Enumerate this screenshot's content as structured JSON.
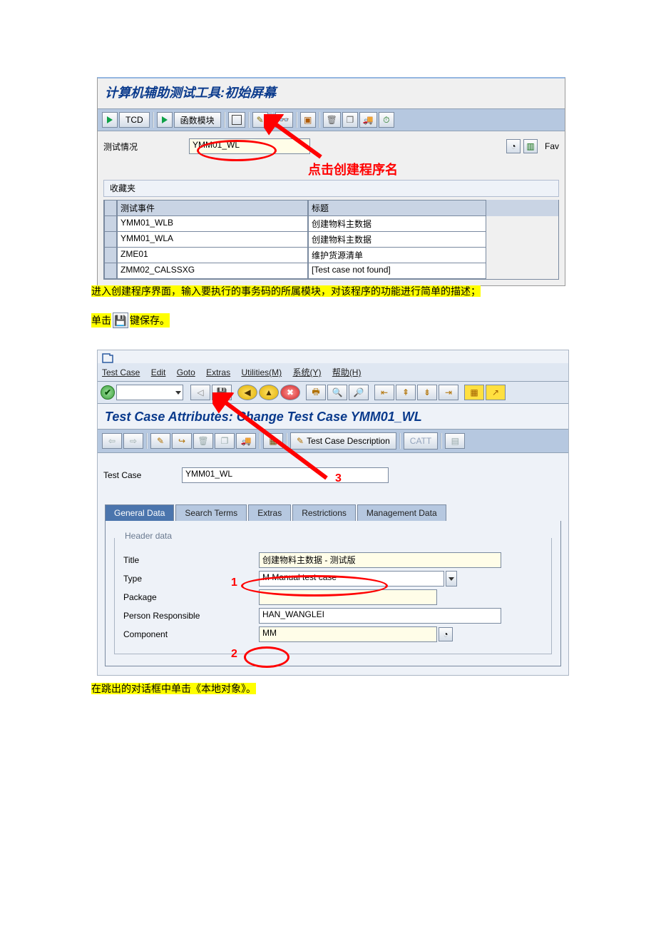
{
  "screenshot1": {
    "title": "计算机辅助测试工具:初始屏幕",
    "toolbar": {
      "tcd": "TCD",
      "fnmod": "函数模块"
    },
    "test_status_label": "测试情况",
    "test_status_value": "YMM01_WL",
    "fav_right": "Fav",
    "fav_header": "收藏夹",
    "cols": {
      "event": "测试事件",
      "title": "标题"
    },
    "rows": [
      {
        "event": "YMM01_WLB",
        "title": "创建物料主数据"
      },
      {
        "event": "YMM01_WLA",
        "title": "创建物料主数据"
      },
      {
        "event": "ZME01",
        "title": "维护货源清单"
      },
      {
        "event": "ZMM02_CALSSXG",
        "title": "[Test case not found]"
      }
    ]
  },
  "annot1": {
    "callout": "点击创建程序名"
  },
  "line1": "进入创建程序界面，输入要执行的事务码的所属模块，对该程序的功能进行简单的描述；",
  "line2a": "单击",
  "line2b": "键保存。",
  "screenshot2": {
    "menu": {
      "m1": "Test Case",
      "m2": "Edit",
      "m3": "Goto",
      "m4": "Extras",
      "m5": "Utilities(M)",
      "m6": "系统(Y)",
      "m7": "帮助(H)"
    },
    "title": "Test Case Attributes: Change Test Case YMM01_WL",
    "tbar": {
      "desc": "Test Case Description",
      "catt": "CATT"
    },
    "tc_label": "Test Case",
    "tc_value": "YMM01_WL",
    "tabs": {
      "t1": "General Data",
      "t2": "Search Terms",
      "t3": "Extras",
      "t4": "Restrictions",
      "t5": "Management Data"
    },
    "group_caption": "Header data",
    "fields": {
      "title_l": "Title",
      "title_v": "创建物料主数据 - 测试版",
      "type_l": "Type",
      "type_v": "M Manual test case",
      "package_l": "Package",
      "package_v": "",
      "resp_l": "Person Responsible",
      "resp_v": "HAN_WANGLEI",
      "comp_l": "Component",
      "comp_v": "MM"
    }
  },
  "annot2": {
    "n1": "1",
    "n2": "2",
    "n3": "3"
  },
  "line3": "在跳出的对话框中单击《本地对象》。"
}
